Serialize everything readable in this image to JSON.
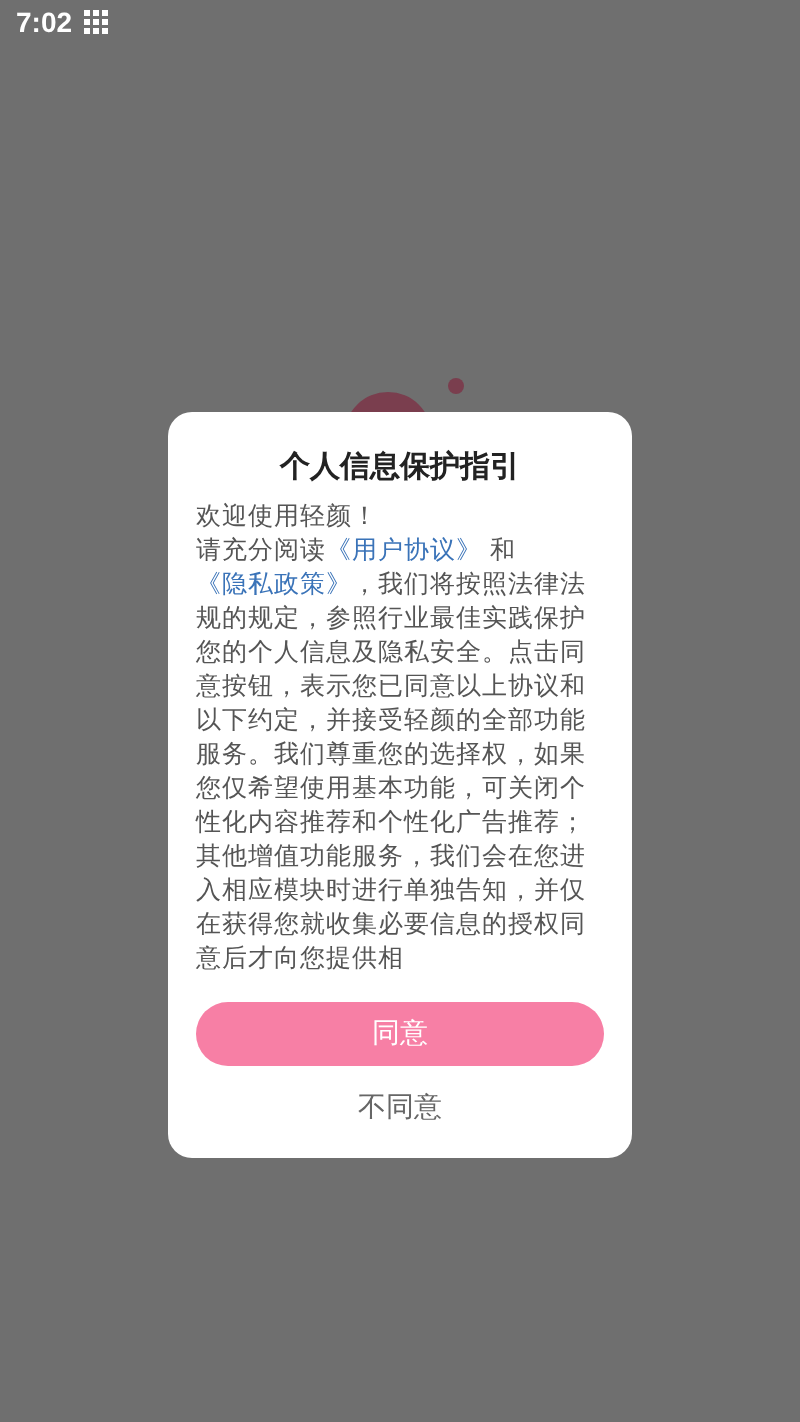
{
  "status_bar": {
    "time": "7:02"
  },
  "dialog": {
    "title": "个人信息保护指引",
    "greeting": "欢迎使用轻颜！",
    "parts": [
      {
        "kind": "plain",
        "text": "请充分阅读"
      },
      {
        "kind": "link",
        "text": "《用户协议》"
      },
      {
        "kind": "plain",
        "text": " 和 "
      },
      {
        "kind": "link",
        "text": "《隐私政策》"
      },
      {
        "kind": "plain",
        "text": "，我们将按照法律法规的规定，参照行业最佳实践保护您的个人信息及隐私安全。点击同意按钮，表示您已同意以上协议和以下约定，并接受轻颜的全部功能服务。我们尊重您的选择权，如果您仅希望使用基本功能，可关闭个性化内容推荐和个性化广告推荐；其他增值功能服务，我们会在您进入相应模块时进行单独告知，并仅在获得您就收集必要信息的授权同意后才向您提供相"
      }
    ],
    "agree_button": "同意",
    "disagree_button": "不同意"
  }
}
